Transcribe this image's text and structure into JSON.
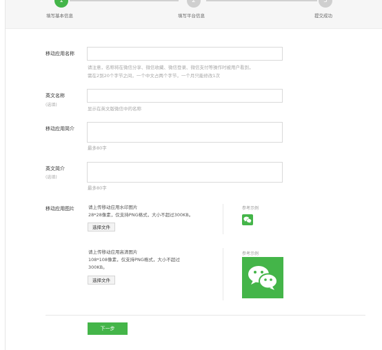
{
  "steps": [
    {
      "num": "1",
      "label": "填写基本信息",
      "state": "active"
    },
    {
      "num": "2",
      "label": "填写平台信息",
      "state": "inactive"
    },
    {
      "num": "3",
      "label": "提交成功",
      "state": "inactive"
    }
  ],
  "form": {
    "app_name": {
      "label": "移动应用名称",
      "value": "",
      "hint_line1": "请注意，名称将在微信分享、微信收藏、微信登录、微信支付等操作时被用户看到，",
      "hint_line2": "需在2到20个字节之间，一个中文占两个字节，一个月只能修改1次"
    },
    "english_name": {
      "label": "英文名称",
      "optional": "(选填)",
      "value": "",
      "hint": "显示在英文版微信中的名称"
    },
    "app_intro": {
      "label": "移动应用简介",
      "value": "",
      "hint": "最多80字"
    },
    "english_intro": {
      "label": "英文简介",
      "optional": "(选填)",
      "value": "",
      "hint": "最多80字"
    },
    "app_images": {
      "label": "移动应用图片",
      "watermark": {
        "desc_line1": "请上传移动应用水印图片",
        "desc_line2": "28*28像素，仅支持PNG格式，大小不超过300KB。",
        "button": "选择文件",
        "ref_label": "参考示例"
      },
      "hd": {
        "desc_line1": "请上传移动应用高清图片",
        "desc_line2": "108*108像素，仅支持PNG格式，大小不超过",
        "desc_line3": "300KB。",
        "button": "选择文件",
        "ref_label": "参考示例"
      }
    }
  },
  "next_button": "下一步",
  "colors": {
    "accent": "#44b549",
    "inactive_step": "#cfcfcf"
  },
  "icons": {
    "wechat_logo": "wechat-logo-icon"
  }
}
